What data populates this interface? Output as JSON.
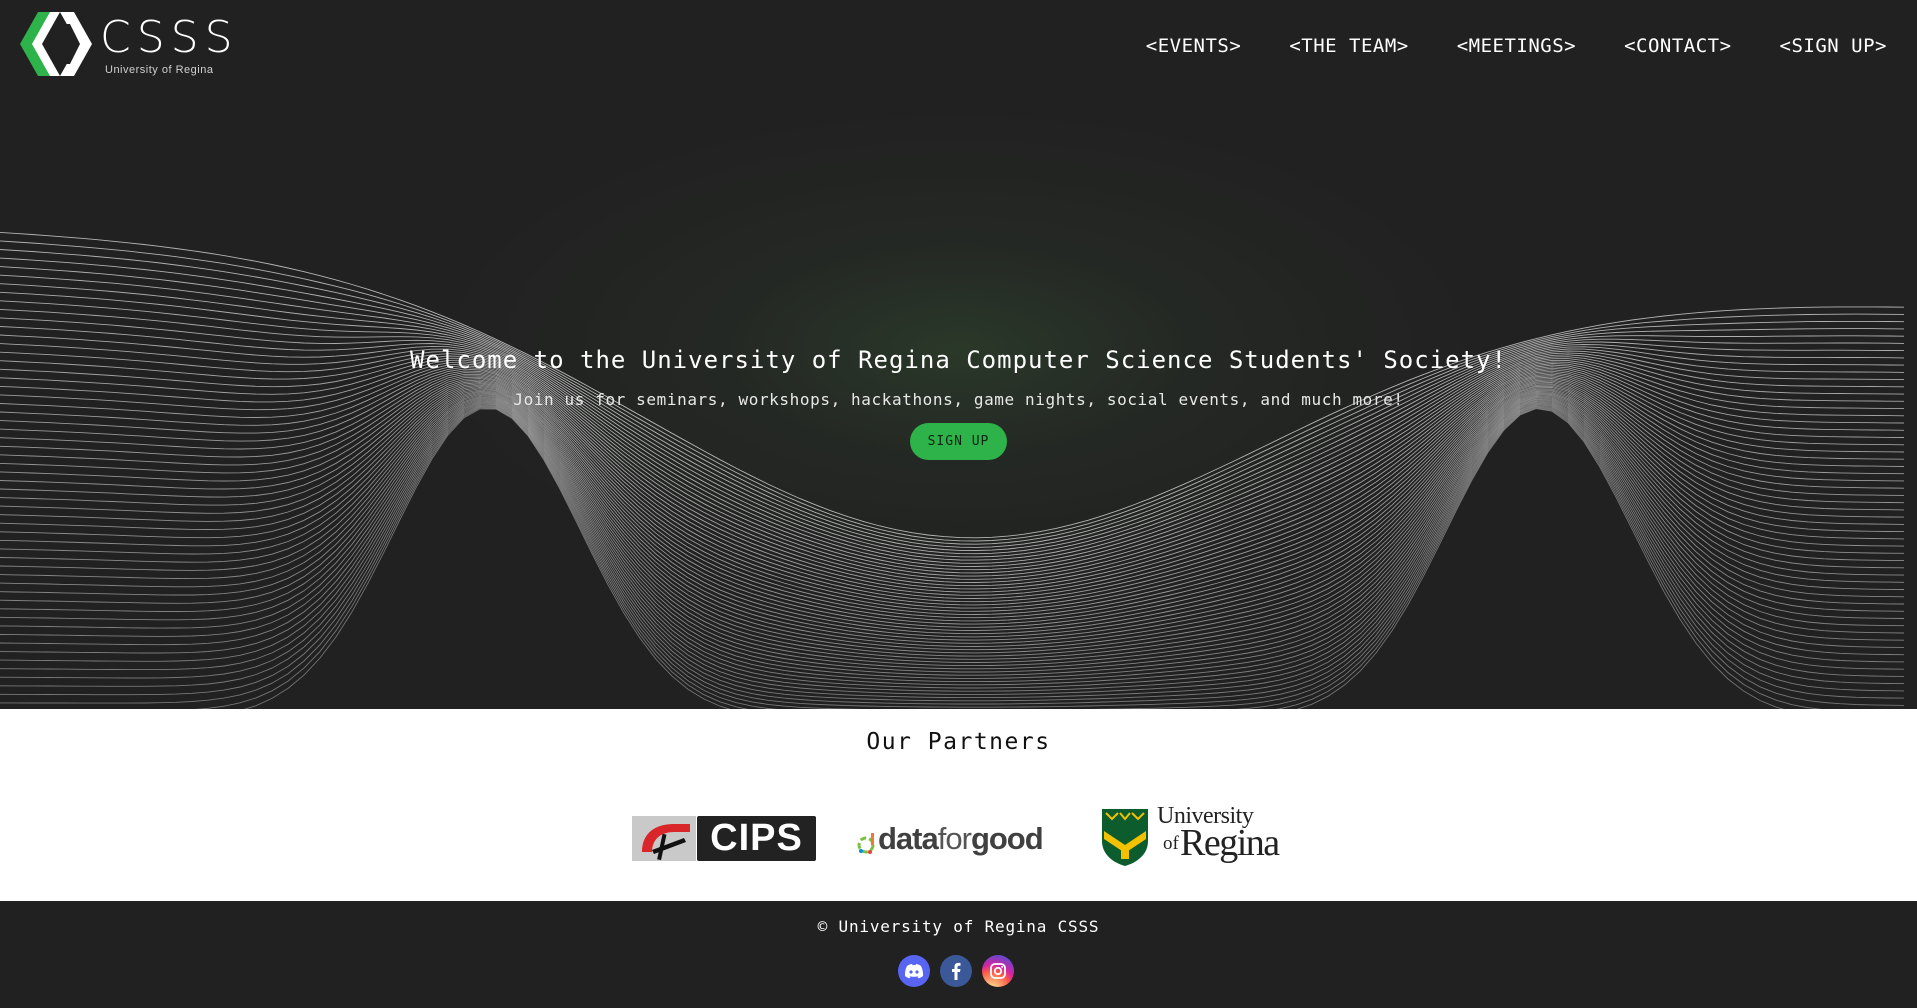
{
  "brand": {
    "name": "CSSS",
    "subtitle": "University of Regina",
    "accent_color": "#2eb24a",
    "background_color": "#212121"
  },
  "nav": {
    "items": [
      {
        "label": "<EVENTS>"
      },
      {
        "label": "<THE TEAM>"
      },
      {
        "label": "<MEETINGS>"
      },
      {
        "label": "<CONTACT>"
      },
      {
        "label": "<SIGN UP>"
      }
    ]
  },
  "hero": {
    "title": "Welcome to the University of Regina Computer Science Students' Society!",
    "subtitle": "Join us for seminars, workshops, hackathons, game nights, social events, and much more!",
    "cta_label": "SIGN UP"
  },
  "partners": {
    "heading": "Our Partners",
    "items": [
      {
        "name": "CIPS",
        "logo_text": "CIPS"
      },
      {
        "name": "dataforgood",
        "logo_text_1": "data",
        "logo_text_2": "for",
        "logo_text_3": "good"
      },
      {
        "name": "University of Regina",
        "logo_text_top": "University",
        "logo_text_of": "of",
        "logo_text_bottom": "Regina"
      }
    ]
  },
  "footer": {
    "copyright": "© University of Regina CSSS",
    "socials": [
      {
        "name": "Discord",
        "icon": "discord-icon",
        "color": "#5865f2"
      },
      {
        "name": "Facebook",
        "icon": "facebook-icon",
        "color": "#3b5998"
      },
      {
        "name": "Instagram",
        "icon": "instagram-icon",
        "color": "#d6249f"
      }
    ]
  }
}
